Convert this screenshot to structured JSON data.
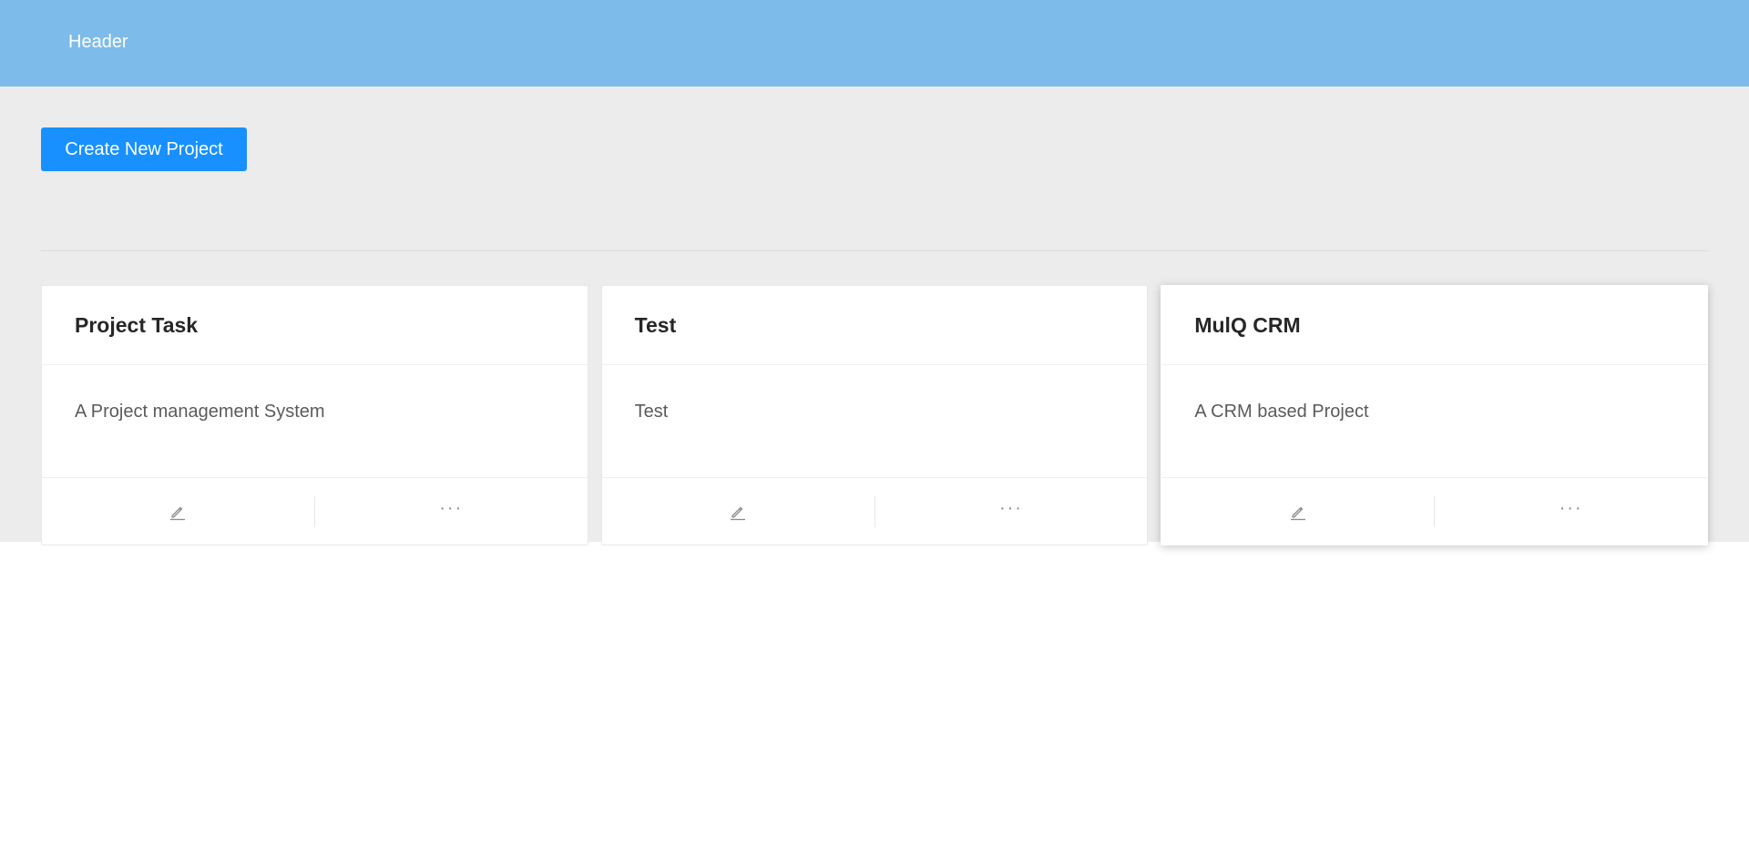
{
  "header": {
    "title": "Header"
  },
  "toolbar": {
    "create_label": "Create New Project"
  },
  "projects": [
    {
      "title": "Project Task",
      "description": "A Project management System",
      "edit_icon": "edit-icon",
      "more_icon": "ellipsis-icon"
    },
    {
      "title": "Test",
      "description": "Test",
      "edit_icon": "edit-icon",
      "more_icon": "ellipsis-icon"
    },
    {
      "title": "MulQ CRM",
      "description": "A CRM based Project",
      "edit_icon": "edit-icon",
      "more_icon": "ellipsis-icon"
    }
  ],
  "colors": {
    "header_bg": "#7dbbea",
    "primary": "#1890ff",
    "content_bg": "#ececec"
  }
}
